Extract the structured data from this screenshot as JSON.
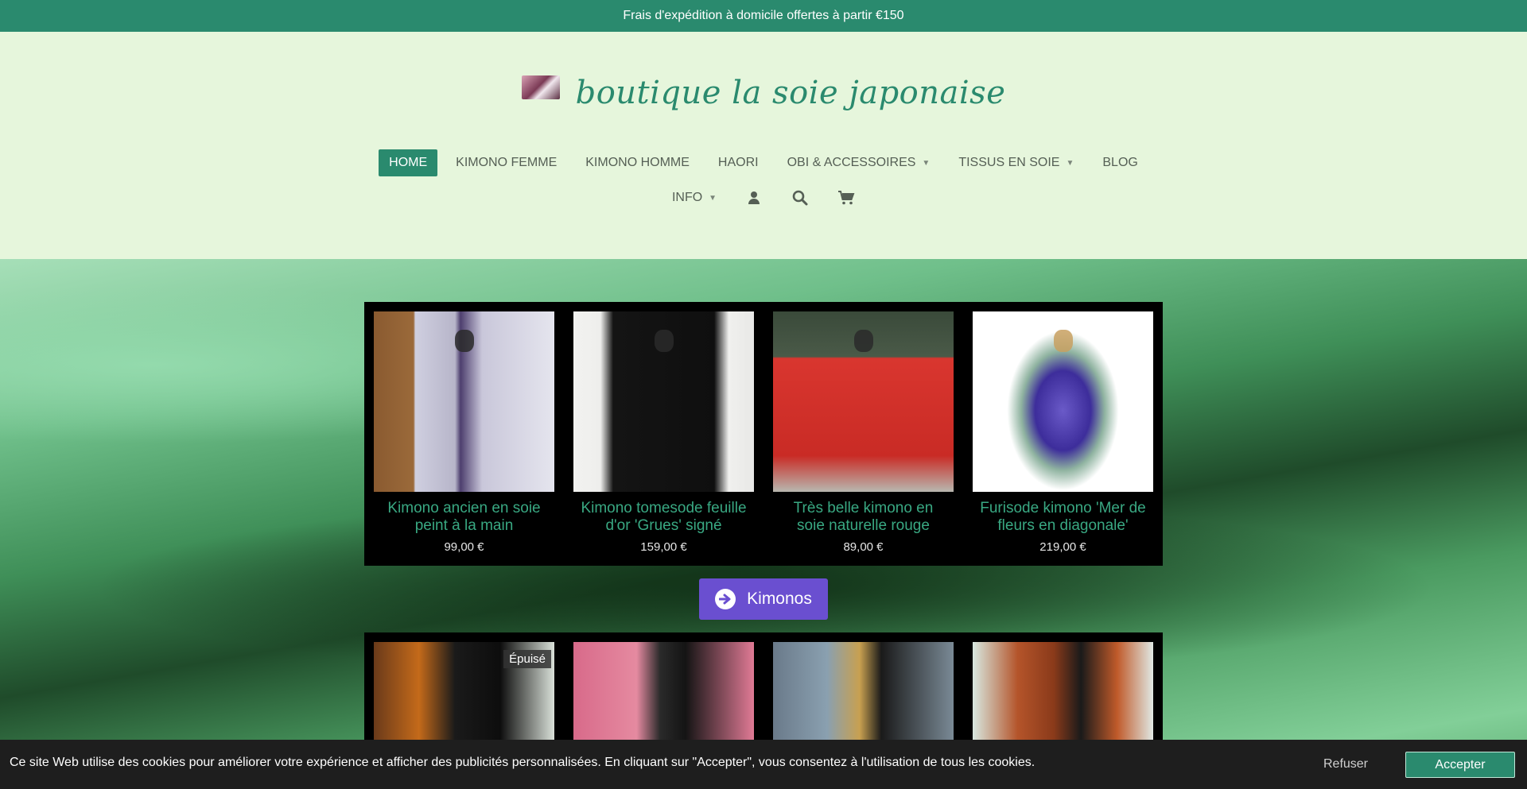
{
  "announcement": {
    "text": "Frais d'expédition à domicile offertes à partir €150"
  },
  "brand": {
    "name": "boutique la soie japonaise"
  },
  "colors": {
    "brand_green": "#2a8a6e",
    "header_bg": "#e6f6dc",
    "cta_purple": "#6a4fd0",
    "product_title": "#39a882"
  },
  "nav": {
    "row1": [
      {
        "label": "HOME",
        "active": true
      },
      {
        "label": "KIMONO FEMME"
      },
      {
        "label": "KIMONO HOMME"
      },
      {
        "label": "HAORI"
      },
      {
        "label": "OBI & ACCESSOIRES",
        "dropdown": true
      },
      {
        "label": "TISSUS EN SOIE",
        "dropdown": true
      },
      {
        "label": "BLOG"
      }
    ],
    "row2": {
      "info_label": "INFO",
      "icons": [
        "user-icon",
        "search-icon",
        "cart-icon"
      ]
    }
  },
  "products_row1": [
    {
      "title": "Kimono ancien en soie peint à la main",
      "price": "99,00 €"
    },
    {
      "title": "Kimono tomesode feuille d'or 'Grues' signé",
      "price": "159,00 €"
    },
    {
      "title": "Très belle kimono en soie naturelle rouge",
      "price": "89,00 €"
    },
    {
      "title": "Furisode kimono 'Mer de fleurs en diagonale'",
      "price": "219,00 €"
    }
  ],
  "cta": {
    "label": "Kimonos",
    "icon": "arrow-right-circle-icon"
  },
  "products_row2": [
    {
      "badge": "Épuisé"
    },
    {},
    {},
    {}
  ],
  "cookie": {
    "text": "Ce site Web utilise des cookies pour améliorer votre expérience et afficher des publicités personnalisées. En cliquant sur \"Accepter\", vous consentez à l'utilisation de tous les cookies.",
    "refuse_label": "Refuser",
    "accept_label": "Accepter"
  }
}
